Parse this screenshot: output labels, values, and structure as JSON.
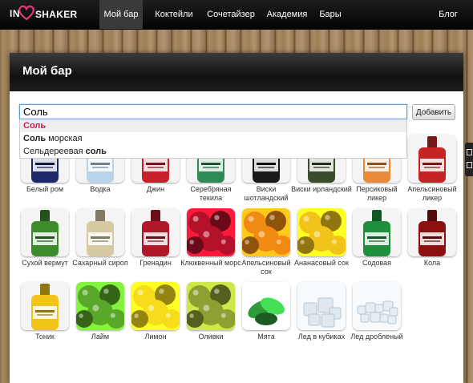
{
  "logo": {
    "prefix": "IN",
    "name": "SHAKER"
  },
  "nav": {
    "items": [
      {
        "label": "Мой бар",
        "active": true
      },
      {
        "label": "Коктейли",
        "active": false
      },
      {
        "label": "Сочетайзер",
        "active": false
      },
      {
        "label": "Академия",
        "active": false
      },
      {
        "label": "Бары",
        "active": false
      }
    ],
    "blog": "Блог"
  },
  "page": {
    "title": "Мой бар"
  },
  "search": {
    "value": "Соль",
    "add_label": "Добавить"
  },
  "autocomplete": [
    {
      "match": "Соль",
      "rest": "",
      "selected": true
    },
    {
      "match": "Соль",
      "rest": " морская",
      "selected": false
    },
    {
      "prefix": "Сельдереевая ",
      "match": "соль",
      "selected": false
    }
  ],
  "ingredients": [
    {
      "name": "Белый ром",
      "icon": "bacardi-bottle-icon",
      "color": "#1c2a6b"
    },
    {
      "name": "Водка",
      "icon": "absolut-vodka-bottle-icon",
      "color": "#b9d3ea"
    },
    {
      "name": "Джин",
      "icon": "beefeater-gin-bottle-icon",
      "color": "#c8202a"
    },
    {
      "name": "Серебряная текила",
      "icon": "olmeca-tequila-bottle-icon",
      "color": "#2f8b55"
    },
    {
      "name": "Виски шотландский",
      "icon": "black-label-whisky-bottle-icon",
      "color": "#1a1a1a"
    },
    {
      "name": "Виски ирландский",
      "icon": "bushmills-whiskey-bottle-icon",
      "color": "#3a4d2a"
    },
    {
      "name": "Персиковый ликер",
      "icon": "peachtree-liqueur-bottle-icon",
      "color": "#e98a3a"
    },
    {
      "name": "Апельсиновый ликер",
      "icon": "dekuyper-liqueur-bottle-icon",
      "color": "#c42424"
    },
    {
      "name": "Сухой вермут",
      "icon": "martini-vermouth-bottle-icon",
      "color": "#3c8a2a"
    },
    {
      "name": "Сахарный сироп",
      "icon": "monin-sugar-syrup-bottle-icon",
      "color": "#d7c9a2"
    },
    {
      "name": "Гренадин",
      "icon": "monin-grenadine-bottle-icon",
      "color": "#b0182a"
    },
    {
      "name": "Клюквенный морс",
      "icon": "cranberry-icon",
      "color": "#b3122a"
    },
    {
      "name": "Апельсиновый сок",
      "icon": "orange-juice-icon",
      "color": "#f08a12"
    },
    {
      "name": "Ананасовый сок",
      "icon": "pineapple-icon",
      "color": "#f2c419"
    },
    {
      "name": "Содовая",
      "icon": "perrier-soda-bottle-icon",
      "color": "#1f8f3c"
    },
    {
      "name": "Кола",
      "icon": "cola-bottle-icon",
      "color": "#8c1010"
    },
    {
      "name": "Тоник",
      "icon": "schweppes-tonic-bottle-icon",
      "color": "#f2c418"
    },
    {
      "name": "Лайм",
      "icon": "lime-icon",
      "color": "#5aa82a"
    },
    {
      "name": "Лимон",
      "icon": "lemon-icon",
      "color": "#f6dc1a"
    },
    {
      "name": "Оливки",
      "icon": "olives-icon",
      "color": "#8fa032"
    },
    {
      "name": "Мята",
      "icon": "mint-leaves-icon",
      "color": "#2e9a3a"
    },
    {
      "name": "Лед в кубиках",
      "icon": "ice-cubes-icon",
      "color": "#dfe8ee"
    },
    {
      "name": "Лед дробленый",
      "icon": "crushed-ice-icon",
      "color": "#e6eef3"
    }
  ]
}
